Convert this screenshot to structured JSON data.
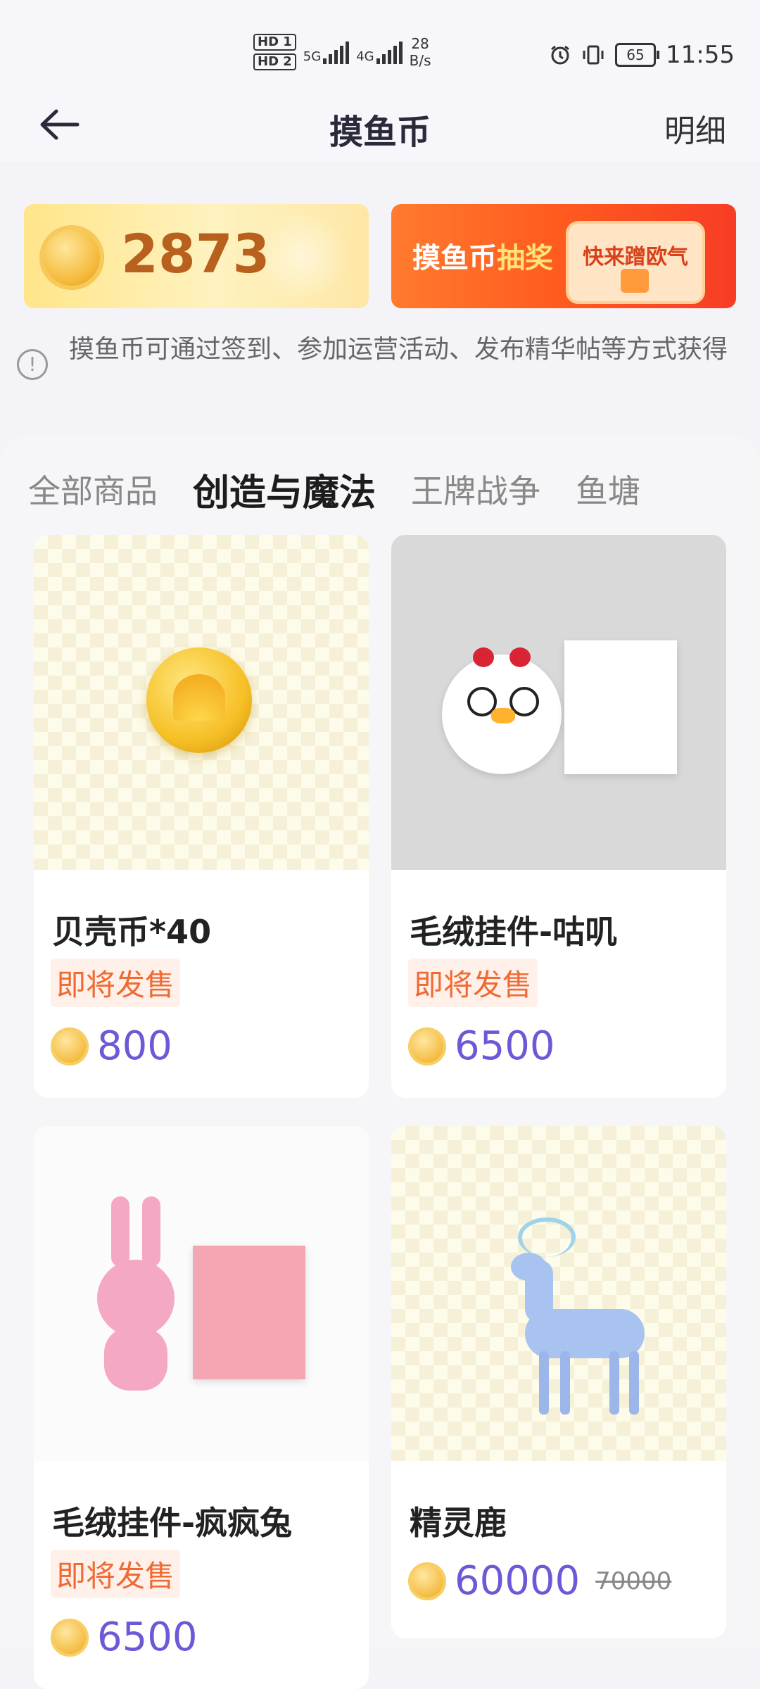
{
  "status_bar": {
    "hd1": "HD 1",
    "hd2": "HD 2",
    "net1": "5G",
    "net2": "4G",
    "speed_value": "28",
    "speed_unit": "B/s",
    "battery": "65",
    "time": "11:55"
  },
  "header": {
    "title": "摸鱼币",
    "detail": "明细"
  },
  "balance": {
    "value": "2873"
  },
  "lottery": {
    "label_a": "摸鱼币",
    "label_b": "抽奖",
    "tag": "快来蹭欧气"
  },
  "info": {
    "text": "摸鱼币可通过签到、参加运营活动、发布精华帖等方式获得"
  },
  "tabs": [
    {
      "label": "全部商品"
    },
    {
      "label": "创造与魔法"
    },
    {
      "label": "王牌战争"
    },
    {
      "label": "鱼塘"
    }
  ],
  "products": [
    {
      "name": "贝壳币*40",
      "badge": "即将发售",
      "price": "800"
    },
    {
      "name": "毛绒挂件-咕叽",
      "badge": "即将发售",
      "price": "6500"
    },
    {
      "name": "毛绒挂件-疯疯兔",
      "badge": "即将发售",
      "price": "6500"
    },
    {
      "name": "精灵鹿",
      "price": "60000",
      "original_price": "70000"
    }
  ]
}
